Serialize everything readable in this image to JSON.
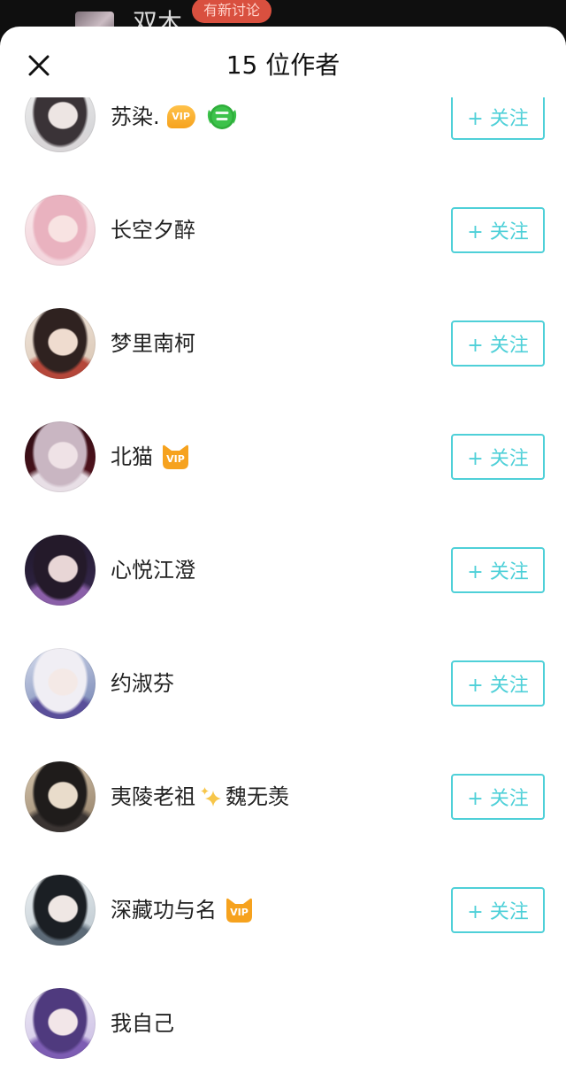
{
  "background": {
    "title": "双木",
    "new_discussion_badge": "有新讨论"
  },
  "sheet": {
    "title": "15 位作者",
    "close_icon": "close-icon"
  },
  "colors": {
    "accent": "#4fd0d8",
    "vip": "#f6a21e",
    "badge_red": "#d9503f",
    "green": "#3cc24a",
    "sparkle": "#f7c64a"
  },
  "authors": [
    {
      "name": "苏染.",
      "badges": [
        {
          "type": "vip-round",
          "label": "VIP"
        },
        {
          "type": "green",
          "icon": "green-badge-icon"
        }
      ],
      "follow_button": "+ 关注",
      "avatar_colors": [
        "#efefef",
        "#cfcfd2",
        "#3a3337",
        "#ede5e3",
        "#d9d6d8"
      ]
    },
    {
      "name": "长空夕醉",
      "badges": [],
      "follow_button": "+ 关注",
      "avatar_colors": [
        "#fbeef0",
        "#efc9d2",
        "#e9b2bf",
        "#f8e3e2",
        "#f4d7de"
      ]
    },
    {
      "name": "梦里南柯",
      "badges": [],
      "follow_button": "+ 关注",
      "avatar_colors": [
        "#f2e8de",
        "#d7c3b0",
        "#2f2220",
        "#efdccf",
        "#b5473a"
      ]
    },
    {
      "name": "北猫",
      "badges": [
        {
          "type": "vip-cat",
          "label": "VIP"
        }
      ],
      "follow_button": "+ 关注",
      "avatar_colors": [
        "#2b0c12",
        "#5a1420",
        "#c9b6c2",
        "#efe2e6",
        "#e8dfe6"
      ]
    },
    {
      "name": "心悦江澄",
      "badges": [],
      "follow_button": "+ 关注",
      "avatar_colors": [
        "#1d1728",
        "#3a2a52",
        "#241a2a",
        "#e8d6d6",
        "#8a5fa8"
      ]
    },
    {
      "name": "约淑芬",
      "badges": [],
      "follow_button": "+ 关注",
      "avatar_colors": [
        "#d5dced",
        "#6f7fb0",
        "#f0eef4",
        "#f4e9e6",
        "#5a4f9a"
      ]
    },
    {
      "name": "夷陵老祖",
      "name_icon": "sparkles-icon",
      "name_after": "魏无羡",
      "badges": [],
      "follow_button": "+ 关注",
      "avatar_colors": [
        "#d8c8b0",
        "#8f7b63",
        "#1f1c1b",
        "#e9dccb",
        "#3a3432"
      ]
    },
    {
      "name": "深藏功与名",
      "badges": [
        {
          "type": "vip-cat",
          "label": "VIP"
        }
      ],
      "follow_button": "+ 关注",
      "avatar_colors": [
        "#eef2f4",
        "#b8c4cc",
        "#1b1f24",
        "#efe7e4",
        "#5d6b78"
      ]
    },
    {
      "name": "我自己",
      "badges": [],
      "avatar_colors": [
        "#f1eef7",
        "#c7b9e2",
        "#4f3a7e",
        "#f2e6e8",
        "#7d5db3"
      ]
    }
  ]
}
